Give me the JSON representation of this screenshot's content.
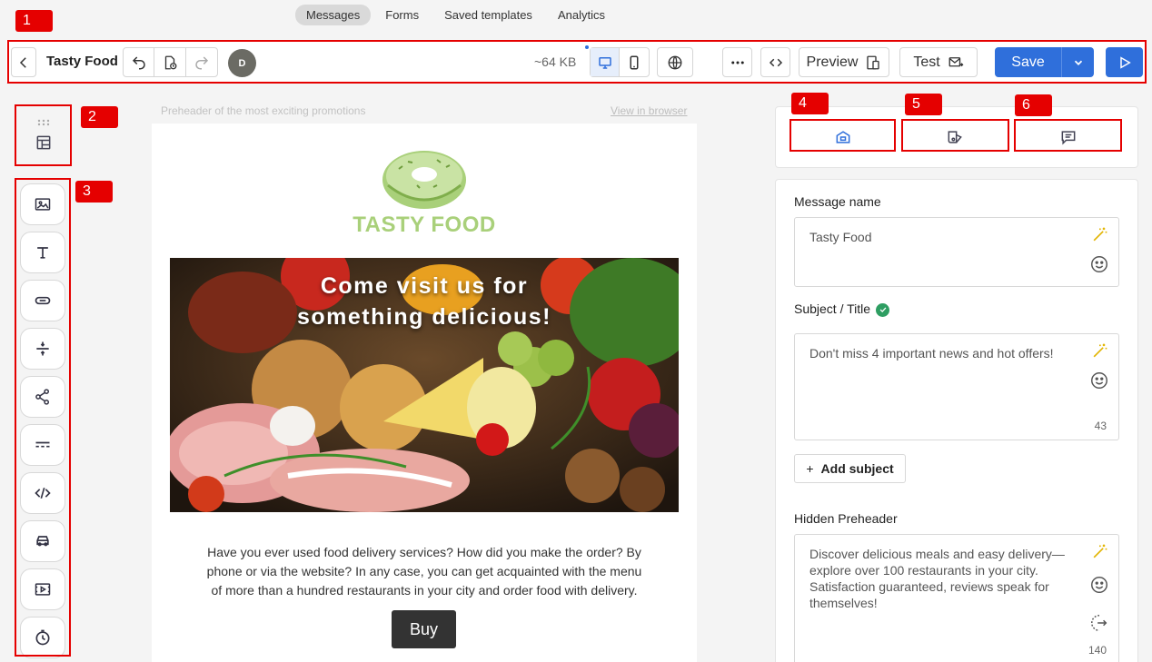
{
  "topnav": {
    "tabs": [
      "Messages",
      "Forms",
      "Saved templates",
      "Analytics"
    ]
  },
  "markers": [
    "1",
    "2",
    "3",
    "4",
    "5",
    "6"
  ],
  "toolbar": {
    "back_icon": "chevron-left-icon",
    "title": "Tasty Food",
    "avatar": "D",
    "size": "~64 KB",
    "preview_label": "Preview",
    "test_label": "Test",
    "save_label": "Save"
  },
  "canvas": {
    "preheader": "Preheader of the most exciting promotions",
    "view_in_browser": "View in browser",
    "brand": "TASTY FOOD",
    "hero_line1": "Come visit us for",
    "hero_line2": "something delicious!",
    "body": "Have you ever used food delivery services? How did you make the order? By phone or via the website? In any case, you can get acquainted with the menu of more than a hundred restaurants in your city and order food with delivery.",
    "button": "Buy"
  },
  "rail": {
    "items": [
      "image-icon",
      "text-icon",
      "button-icon",
      "spacer-icon",
      "social-icon",
      "divider-icon",
      "html-icon",
      "menu-icon",
      "video-icon",
      "timer-icon"
    ]
  },
  "panel": {
    "message_name_label": "Message name",
    "message_name_value": "Tasty Food",
    "subject_label": "Subject / Title",
    "subject_value": "Don't miss 4 important news and hot offers!",
    "subject_count": "43",
    "add_subject": "Add subject",
    "preheader_label": "Hidden Preheader",
    "preheader_value": "Discover delicious meals and easy delivery—explore over 100 restaurants in your city. Satisfaction guaranteed, reviews speak for themselves!",
    "preheader_count": "140"
  },
  "colors": {
    "accent": "#2f6fdb",
    "marker": "#e50000",
    "brand_green": "#a9d07a"
  }
}
